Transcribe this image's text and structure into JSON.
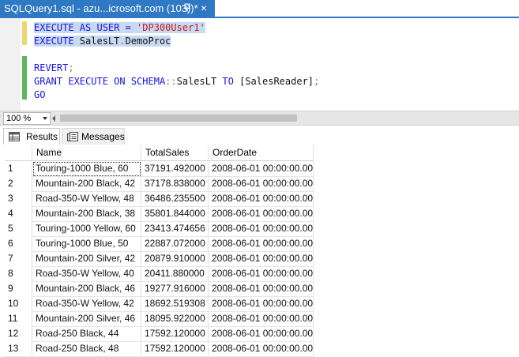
{
  "tab": {
    "title": "SQLQuery1.sql - azu...icrosoft.com (103))*",
    "close_glyph": "×"
  },
  "editor": {
    "lines": [
      {
        "segments": [
          {
            "t": "EXECUTE AS USER = ",
            "c": "kw",
            "sel": true
          },
          {
            "t": "'DP300User1'",
            "c": "str",
            "sel": true
          }
        ]
      },
      {
        "segments": [
          {
            "t": "EXECUTE ",
            "c": "kw",
            "sel": true
          },
          {
            "t": "SalesLT",
            "c": "txt",
            "sel": true
          },
          {
            "t": ".",
            "c": "gray",
            "sel": true
          },
          {
            "t": "DemoProc",
            "c": "txt",
            "sel": true
          }
        ]
      },
      {
        "segments": []
      },
      {
        "segments": [
          {
            "t": "REVERT",
            "c": "kw",
            "sel": false
          },
          {
            "t": ";",
            "c": "gray",
            "sel": false
          }
        ]
      },
      {
        "segments": [
          {
            "t": "GRANT EXECUTE ON SCHEMA",
            "c": "kw",
            "sel": false
          },
          {
            "t": "::",
            "c": "gray",
            "sel": false
          },
          {
            "t": "SalesLT ",
            "c": "txt",
            "sel": false
          },
          {
            "t": "TO ",
            "c": "kw",
            "sel": false
          },
          {
            "t": "[SalesReader]",
            "c": "txt",
            "sel": false
          },
          {
            "t": ";",
            "c": "gray",
            "sel": false
          }
        ]
      },
      {
        "segments": [
          {
            "t": "GO",
            "c": "kw",
            "sel": false
          }
        ]
      }
    ]
  },
  "zoom": {
    "value": "100 %"
  },
  "results_tabs": {
    "results": "Results",
    "messages": "Messages"
  },
  "grid": {
    "columns": [
      "Name",
      "TotalSales",
      "OrderDate"
    ],
    "rows": [
      {
        "n": "1",
        "name": "Touring-1000 Blue, 60",
        "total": "37191.492000",
        "date": "2008-06-01 00:00:00.000"
      },
      {
        "n": "2",
        "name": "Mountain-200 Black, 42",
        "total": "37178.838000",
        "date": "2008-06-01 00:00:00.000"
      },
      {
        "n": "3",
        "name": "Road-350-W Yellow, 48",
        "total": "36486.235500",
        "date": "2008-06-01 00:00:00.000"
      },
      {
        "n": "4",
        "name": "Mountain-200 Black, 38",
        "total": "35801.844000",
        "date": "2008-06-01 00:00:00.000"
      },
      {
        "n": "5",
        "name": "Touring-1000 Yellow, 60",
        "total": "23413.474656",
        "date": "2008-06-01 00:00:00.000"
      },
      {
        "n": "6",
        "name": "Touring-1000 Blue, 50",
        "total": "22887.072000",
        "date": "2008-06-01 00:00:00.000"
      },
      {
        "n": "7",
        "name": "Mountain-200 Silver, 42",
        "total": "20879.910000",
        "date": "2008-06-01 00:00:00.000"
      },
      {
        "n": "8",
        "name": "Road-350-W Yellow, 40",
        "total": "20411.880000",
        "date": "2008-06-01 00:00:00.000"
      },
      {
        "n": "9",
        "name": "Mountain-200 Black, 46",
        "total": "19277.916000",
        "date": "2008-06-01 00:00:00.000"
      },
      {
        "n": "10",
        "name": "Road-350-W Yellow, 42",
        "total": "18692.519308",
        "date": "2008-06-01 00:00:00.000"
      },
      {
        "n": "11",
        "name": "Mountain-200 Silver, 46",
        "total": "18095.922000",
        "date": "2008-06-01 00:00:00.000"
      },
      {
        "n": "12",
        "name": "Road-250 Black, 44",
        "total": "17592.120000",
        "date": "2008-06-01 00:00:00.000"
      },
      {
        "n": "13",
        "name": "Road-250 Black, 48",
        "total": "17592.120000",
        "date": "2008-06-01 00:00:00.000"
      }
    ]
  },
  "colors": {
    "tab_accent": "#2f78c4",
    "keyword": "#1515e0",
    "string": "#c21a1a",
    "selection": "#c8d9f2"
  },
  "icons": {
    "pin": "pin-icon",
    "close": "close-icon",
    "results": "grid-icon",
    "messages": "messages-icon",
    "dropdown": "chevron-down-icon"
  }
}
